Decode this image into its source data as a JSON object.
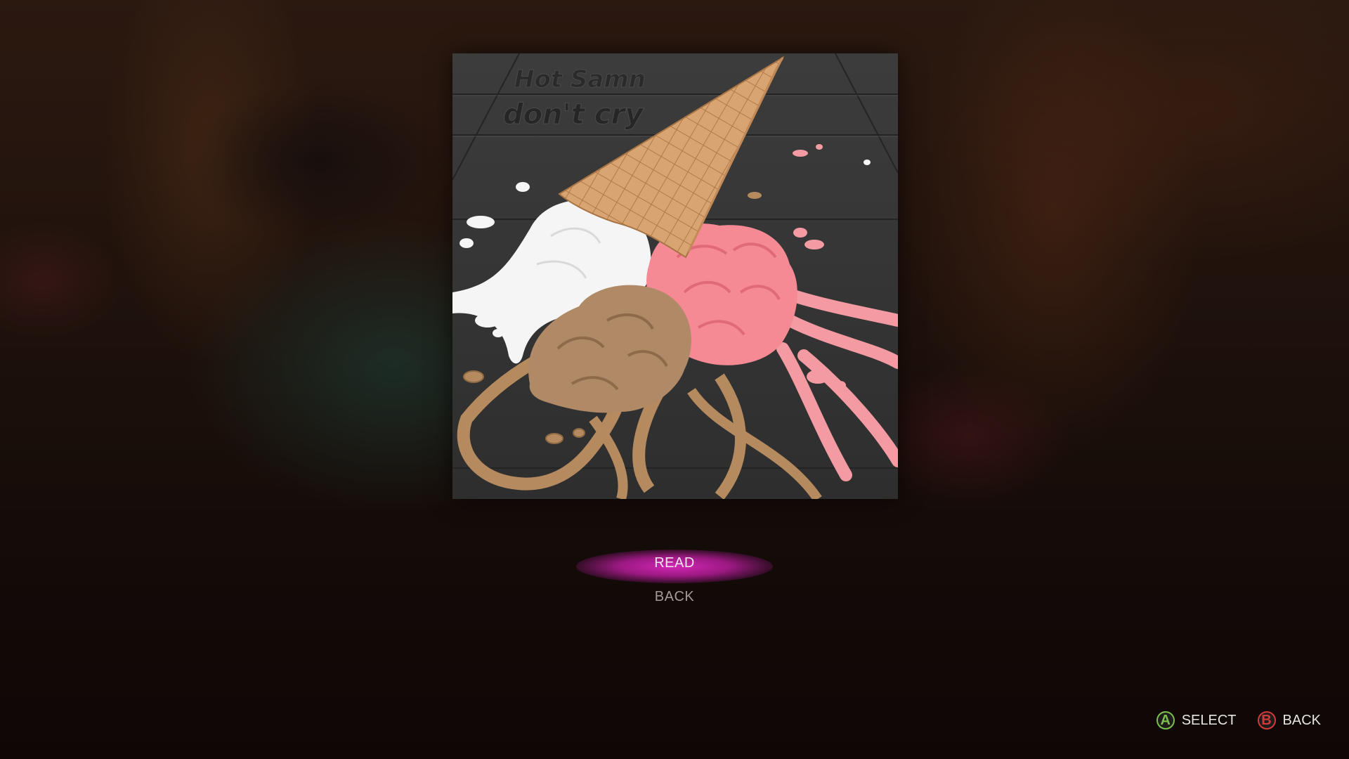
{
  "album": {
    "artist": "Hot Samn",
    "title": "don't cry"
  },
  "menu": {
    "items": [
      {
        "label": "READ",
        "selected": true
      },
      {
        "label": "BACK",
        "selected": false
      }
    ]
  },
  "prompts": [
    {
      "icon": "a-button-icon",
      "glyph": "A",
      "label": "SELECT"
    },
    {
      "icon": "b-button-icon",
      "glyph": "B",
      "label": "BACK"
    }
  ],
  "colors": {
    "highlight": "#d02cb8",
    "a_button": "#7cc04c",
    "b_button": "#d23a3a"
  }
}
